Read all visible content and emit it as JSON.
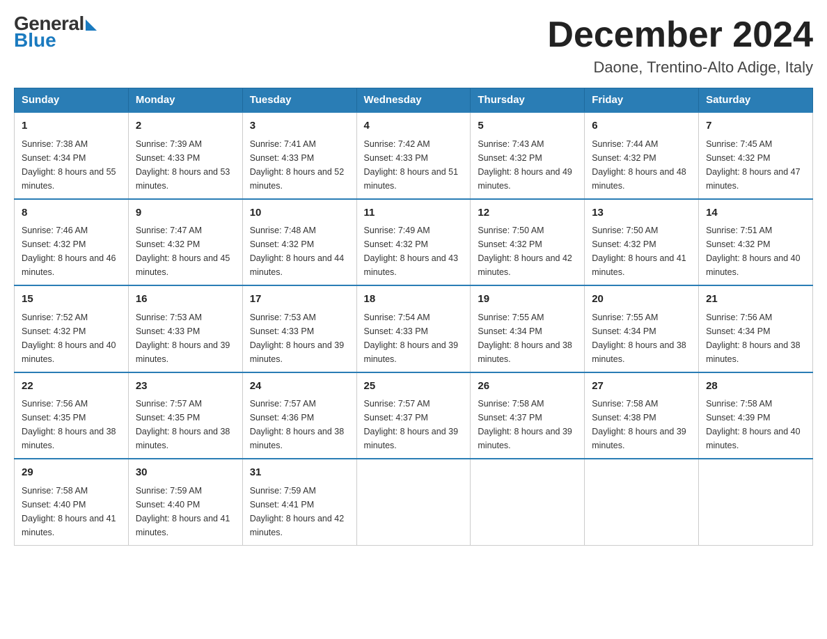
{
  "header": {
    "logo_general": "General",
    "logo_blue": "Blue",
    "month": "December 2024",
    "location": "Daone, Trentino-Alto Adige, Italy"
  },
  "weekdays": [
    "Sunday",
    "Monday",
    "Tuesday",
    "Wednesday",
    "Thursday",
    "Friday",
    "Saturday"
  ],
  "weeks": [
    [
      {
        "day": "1",
        "sunrise": "7:38 AM",
        "sunset": "4:34 PM",
        "daylight": "8 hours and 55 minutes."
      },
      {
        "day": "2",
        "sunrise": "7:39 AM",
        "sunset": "4:33 PM",
        "daylight": "8 hours and 53 minutes."
      },
      {
        "day": "3",
        "sunrise": "7:41 AM",
        "sunset": "4:33 PM",
        "daylight": "8 hours and 52 minutes."
      },
      {
        "day": "4",
        "sunrise": "7:42 AM",
        "sunset": "4:33 PM",
        "daylight": "8 hours and 51 minutes."
      },
      {
        "day": "5",
        "sunrise": "7:43 AM",
        "sunset": "4:32 PM",
        "daylight": "8 hours and 49 minutes."
      },
      {
        "day": "6",
        "sunrise": "7:44 AM",
        "sunset": "4:32 PM",
        "daylight": "8 hours and 48 minutes."
      },
      {
        "day": "7",
        "sunrise": "7:45 AM",
        "sunset": "4:32 PM",
        "daylight": "8 hours and 47 minutes."
      }
    ],
    [
      {
        "day": "8",
        "sunrise": "7:46 AM",
        "sunset": "4:32 PM",
        "daylight": "8 hours and 46 minutes."
      },
      {
        "day": "9",
        "sunrise": "7:47 AM",
        "sunset": "4:32 PM",
        "daylight": "8 hours and 45 minutes."
      },
      {
        "day": "10",
        "sunrise": "7:48 AM",
        "sunset": "4:32 PM",
        "daylight": "8 hours and 44 minutes."
      },
      {
        "day": "11",
        "sunrise": "7:49 AM",
        "sunset": "4:32 PM",
        "daylight": "8 hours and 43 minutes."
      },
      {
        "day": "12",
        "sunrise": "7:50 AM",
        "sunset": "4:32 PM",
        "daylight": "8 hours and 42 minutes."
      },
      {
        "day": "13",
        "sunrise": "7:50 AM",
        "sunset": "4:32 PM",
        "daylight": "8 hours and 41 minutes."
      },
      {
        "day": "14",
        "sunrise": "7:51 AM",
        "sunset": "4:32 PM",
        "daylight": "8 hours and 40 minutes."
      }
    ],
    [
      {
        "day": "15",
        "sunrise": "7:52 AM",
        "sunset": "4:32 PM",
        "daylight": "8 hours and 40 minutes."
      },
      {
        "day": "16",
        "sunrise": "7:53 AM",
        "sunset": "4:33 PM",
        "daylight": "8 hours and 39 minutes."
      },
      {
        "day": "17",
        "sunrise": "7:53 AM",
        "sunset": "4:33 PM",
        "daylight": "8 hours and 39 minutes."
      },
      {
        "day": "18",
        "sunrise": "7:54 AM",
        "sunset": "4:33 PM",
        "daylight": "8 hours and 39 minutes."
      },
      {
        "day": "19",
        "sunrise": "7:55 AM",
        "sunset": "4:34 PM",
        "daylight": "8 hours and 38 minutes."
      },
      {
        "day": "20",
        "sunrise": "7:55 AM",
        "sunset": "4:34 PM",
        "daylight": "8 hours and 38 minutes."
      },
      {
        "day": "21",
        "sunrise": "7:56 AM",
        "sunset": "4:34 PM",
        "daylight": "8 hours and 38 minutes."
      }
    ],
    [
      {
        "day": "22",
        "sunrise": "7:56 AM",
        "sunset": "4:35 PM",
        "daylight": "8 hours and 38 minutes."
      },
      {
        "day": "23",
        "sunrise": "7:57 AM",
        "sunset": "4:35 PM",
        "daylight": "8 hours and 38 minutes."
      },
      {
        "day": "24",
        "sunrise": "7:57 AM",
        "sunset": "4:36 PM",
        "daylight": "8 hours and 38 minutes."
      },
      {
        "day": "25",
        "sunrise": "7:57 AM",
        "sunset": "4:37 PM",
        "daylight": "8 hours and 39 minutes."
      },
      {
        "day": "26",
        "sunrise": "7:58 AM",
        "sunset": "4:37 PM",
        "daylight": "8 hours and 39 minutes."
      },
      {
        "day": "27",
        "sunrise": "7:58 AM",
        "sunset": "4:38 PM",
        "daylight": "8 hours and 39 minutes."
      },
      {
        "day": "28",
        "sunrise": "7:58 AM",
        "sunset": "4:39 PM",
        "daylight": "8 hours and 40 minutes."
      }
    ],
    [
      {
        "day": "29",
        "sunrise": "7:58 AM",
        "sunset": "4:40 PM",
        "daylight": "8 hours and 41 minutes."
      },
      {
        "day": "30",
        "sunrise": "7:59 AM",
        "sunset": "4:40 PM",
        "daylight": "8 hours and 41 minutes."
      },
      {
        "day": "31",
        "sunrise": "7:59 AM",
        "sunset": "4:41 PM",
        "daylight": "8 hours and 42 minutes."
      },
      null,
      null,
      null,
      null
    ]
  ]
}
